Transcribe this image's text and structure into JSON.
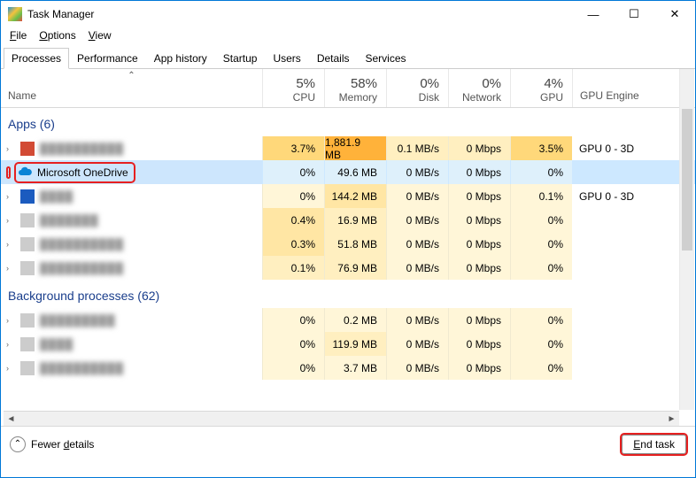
{
  "window": {
    "title": "Task Manager"
  },
  "menu": {
    "file": "File",
    "options": "Options",
    "view": "View"
  },
  "tabs": {
    "processes": "Processes",
    "performance": "Performance",
    "app_history": "App history",
    "startup": "Startup",
    "users": "Users",
    "details": "Details",
    "services": "Services"
  },
  "header": {
    "name": "Name",
    "cpu_pct": "5%",
    "cpu": "CPU",
    "mem_pct": "58%",
    "mem": "Memory",
    "disk_pct": "0%",
    "disk": "Disk",
    "net_pct": "0%",
    "net": "Network",
    "gpu_pct": "4%",
    "gpu": "GPU",
    "gpu_engine": "GPU Engine"
  },
  "categories": {
    "apps": "Apps (6)",
    "bg": "Background processes (62)"
  },
  "rows": [
    {
      "name": "██████████",
      "cpu": "3.7%",
      "mem": "1,881.9 MB",
      "disk": "0.1 MB/s",
      "net": "0 Mbps",
      "gpu": "3.5%",
      "engine": "GPU 0 - 3D",
      "heat": {
        "cpu": "h3",
        "mem": "h5",
        "disk": "h1",
        "net": "h1",
        "gpu": "h3"
      },
      "icon": "red"
    },
    {
      "name": "Microsoft OneDrive",
      "cpu": "0%",
      "mem": "49.6 MB",
      "disk": "0 MB/s",
      "net": "0 Mbps",
      "gpu": "0%",
      "engine": "",
      "heat": {
        "cpu": "sel",
        "mem": "sel",
        "disk": "sel",
        "net": "sel",
        "gpu": "sel"
      },
      "icon": "cloud",
      "selected": true
    },
    {
      "name": "████",
      "cpu": "0%",
      "mem": "144.2 MB",
      "disk": "0 MB/s",
      "net": "0 Mbps",
      "gpu": "0.1%",
      "engine": "GPU 0 - 3D",
      "heat": {
        "cpu": "h0",
        "mem": "h2",
        "disk": "h0",
        "net": "h0",
        "gpu": "h0"
      },
      "icon": "blue"
    },
    {
      "name": "███████",
      "cpu": "0.4%",
      "mem": "16.9 MB",
      "disk": "0 MB/s",
      "net": "0 Mbps",
      "gpu": "0%",
      "engine": "",
      "heat": {
        "cpu": "h2",
        "mem": "h1",
        "disk": "h0",
        "net": "h0",
        "gpu": "h0"
      },
      "icon": "gray"
    },
    {
      "name": "██████████",
      "cpu": "0.3%",
      "mem": "51.8 MB",
      "disk": "0 MB/s",
      "net": "0 Mbps",
      "gpu": "0%",
      "engine": "",
      "heat": {
        "cpu": "h2",
        "mem": "h1",
        "disk": "h0",
        "net": "h0",
        "gpu": "h0"
      },
      "icon": "gray"
    },
    {
      "name": "██████████",
      "cpu": "0.1%",
      "mem": "76.9 MB",
      "disk": "0 MB/s",
      "net": "0 Mbps",
      "gpu": "0%",
      "engine": "",
      "heat": {
        "cpu": "h1",
        "mem": "h1",
        "disk": "h0",
        "net": "h0",
        "gpu": "h0"
      },
      "icon": "gray"
    }
  ],
  "bg_rows": [
    {
      "name": "█████████",
      "cpu": "0%",
      "mem": "0.2 MB",
      "disk": "0 MB/s",
      "net": "0 Mbps",
      "gpu": "0%",
      "engine": "",
      "heat": {
        "cpu": "h0",
        "mem": "h0",
        "disk": "h0",
        "net": "h0",
        "gpu": "h0"
      }
    },
    {
      "name": "████",
      "cpu": "0%",
      "mem": "119.9 MB",
      "disk": "0 MB/s",
      "net": "0 Mbps",
      "gpu": "0%",
      "engine": "",
      "heat": {
        "cpu": "h0",
        "mem": "h1",
        "disk": "h0",
        "net": "h0",
        "gpu": "h0"
      }
    },
    {
      "name": "██████████",
      "cpu": "0%",
      "mem": "3.7 MB",
      "disk": "0 MB/s",
      "net": "0 Mbps",
      "gpu": "0%",
      "engine": "",
      "heat": {
        "cpu": "h0",
        "mem": "h0",
        "disk": "h0",
        "net": "h0",
        "gpu": "h0"
      }
    }
  ],
  "footer": {
    "fewer": "Fewer details",
    "end_task": "End task"
  }
}
